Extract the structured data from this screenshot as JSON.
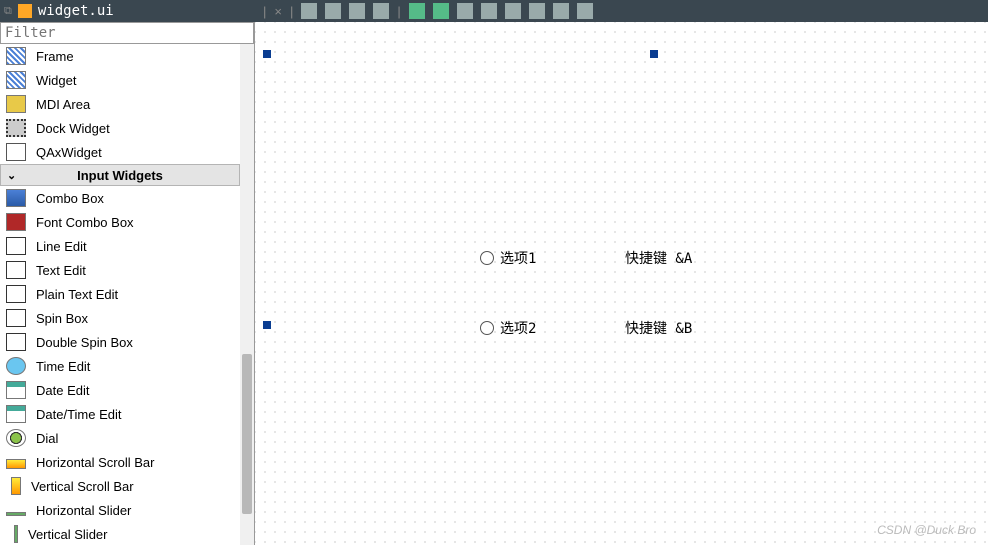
{
  "titlebar": {
    "filename": "widget.ui"
  },
  "filter": {
    "placeholder": "Filter"
  },
  "widget_groups": [
    {
      "header": null,
      "items": [
        {
          "label": "Frame",
          "icon": "frame"
        },
        {
          "label": "Widget",
          "icon": "widget"
        },
        {
          "label": "MDI Area",
          "icon": "mdi"
        },
        {
          "label": "Dock Widget",
          "icon": "dock"
        },
        {
          "label": "QAxWidget",
          "icon": "ax"
        }
      ]
    },
    {
      "header": "Input Widgets",
      "items": [
        {
          "label": "Combo Box",
          "icon": "combo"
        },
        {
          "label": "Font Combo Box",
          "icon": "fontcombo"
        },
        {
          "label": "Line Edit",
          "icon": "lineedit"
        },
        {
          "label": "Text Edit",
          "icon": "textedit"
        },
        {
          "label": "Plain Text Edit",
          "icon": "textedit"
        },
        {
          "label": "Spin Box",
          "icon": "spin"
        },
        {
          "label": "Double Spin Box",
          "icon": "spin"
        },
        {
          "label": "Time Edit",
          "icon": "timeedit"
        },
        {
          "label": "Date Edit",
          "icon": "dateedit"
        },
        {
          "label": "Date/Time Edit",
          "icon": "dateedit"
        },
        {
          "label": "Dial",
          "icon": "dial"
        },
        {
          "label": "Horizontal Scroll Bar",
          "icon": "hscroll"
        },
        {
          "label": "Vertical Scroll Bar",
          "icon": "vscroll"
        },
        {
          "label": "Horizontal Slider",
          "icon": "hslider"
        },
        {
          "label": "Vertical Slider",
          "icon": "vslider"
        }
      ]
    }
  ],
  "canvas": {
    "radio1": {
      "label": "选项1",
      "hint": "快捷键 &A"
    },
    "radio2": {
      "label": "选项2",
      "hint": "快捷键 &B"
    }
  },
  "watermark": "CSDN @Duck Bro",
  "toolbar_sep": "×"
}
